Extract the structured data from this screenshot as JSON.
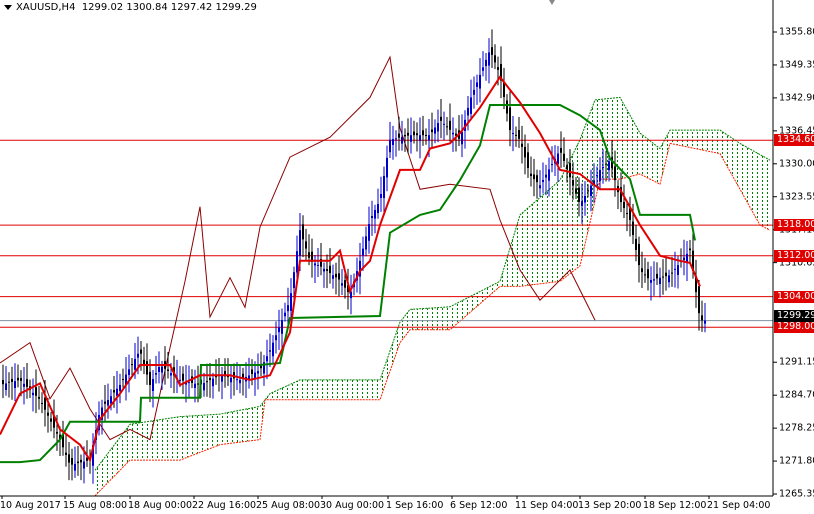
{
  "header": {
    "symbol": "XAUUSD,H4",
    "open": "1299.02",
    "high": "1300.84",
    "low": "1297.42",
    "close": "1299.29"
  },
  "chart_data": {
    "type": "candlestick",
    "title": "XAUUSD,H4",
    "ylim": [
      1262.5,
      1362.0
    ],
    "y_ticks": [
      "1355.80",
      "1349.35",
      "1342.90",
      "1336.45",
      "1330.00",
      "1323.55",
      "1317.10",
      "1310.65",
      "1291.15",
      "1284.70",
      "1278.25",
      "1271.80",
      "1265.35"
    ],
    "x_labels": [
      "10 Aug 2017",
      "15 Aug 08:00",
      "18 Aug 00:00",
      "22 Aug 16:00",
      "25 Aug 08:00",
      "30 Aug 00:00",
      "1 Sep 16:00",
      "6 Sep 12:00",
      "11 Sep 04:00",
      "13 Sep 20:00",
      "18 Sep 12:00",
      "21 Sep 04:00"
    ],
    "x_unit_note": "x in tens-of-bar units from left edge",
    "price_path": [
      [
        0,
        1286.7
      ],
      [
        2,
        1287.7
      ],
      [
        4,
        1283.8
      ],
      [
        6,
        1276
      ],
      [
        7,
        1271
      ],
      [
        9,
        1272
      ],
      [
        10,
        1281.8
      ],
      [
        12,
        1286.7
      ],
      [
        14,
        1293.5
      ],
      [
        15,
        1286.7
      ],
      [
        16,
        1290.6
      ],
      [
        18,
        1287.7
      ],
      [
        20,
        1286.7
      ],
      [
        22,
        1288.6
      ],
      [
        24,
        1287.7
      ],
      [
        26,
        1289.6
      ],
      [
        27,
        1293.5
      ],
      [
        29,
        1303.3
      ],
      [
        30,
        1317
      ],
      [
        31,
        1311
      ],
      [
        32,
        1310
      ],
      [
        34,
        1307.2
      ],
      [
        35,
        1304.3
      ],
      [
        36,
        1311
      ],
      [
        37,
        1319
      ],
      [
        38,
        1322.9
      ],
      [
        39,
        1334.7
      ],
      [
        41,
        1335.6
      ],
      [
        43,
        1335.6
      ],
      [
        44,
        1338.6
      ],
      [
        46,
        1334.7
      ],
      [
        47,
        1342.5
      ],
      [
        49,
        1352.3
      ],
      [
        50,
        1347.4
      ],
      [
        51,
        1336.6
      ],
      [
        52,
        1334.7
      ],
      [
        53,
        1327.8
      ],
      [
        54,
        1325.8
      ],
      [
        56,
        1332.7
      ],
      [
        58,
        1322
      ],
      [
        60,
        1328.8
      ],
      [
        61,
        1330.7
      ],
      [
        62,
        1322.9
      ],
      [
        63,
        1319
      ],
      [
        64,
        1309.2
      ],
      [
        65,
        1307.2
      ],
      [
        67,
        1308.2
      ],
      [
        69,
        1313.1
      ],
      [
        70,
        1299.4
      ],
      [
        70.5,
        1299.3
      ]
    ],
    "tenkan": [
      [
        0,
        1277
      ],
      [
        2,
        1285
      ],
      [
        4,
        1287
      ],
      [
        6,
        1278
      ],
      [
        8,
        1275
      ],
      [
        9,
        1272
      ],
      [
        10,
        1280
      ],
      [
        12,
        1285
      ],
      [
        14,
        1290.6
      ],
      [
        17,
        1290.6
      ],
      [
        18,
        1286.7
      ],
      [
        20,
        1288.6
      ],
      [
        23,
        1288.6
      ],
      [
        25,
        1287.7
      ],
      [
        27,
        1288.6
      ],
      [
        29,
        1297
      ],
      [
        30,
        1311
      ],
      [
        33,
        1311
      ],
      [
        34,
        1313
      ],
      [
        35,
        1305
      ],
      [
        36,
        1309
      ],
      [
        37,
        1311
      ],
      [
        38,
        1318
      ],
      [
        40,
        1328.8
      ],
      [
        42,
        1328.8
      ],
      [
        43,
        1333
      ],
      [
        45,
        1334
      ],
      [
        46,
        1336
      ],
      [
        48,
        1341
      ],
      [
        50,
        1347
      ],
      [
        52,
        1342
      ],
      [
        54,
        1336
      ],
      [
        56,
        1328.8
      ],
      [
        58,
        1328
      ],
      [
        60,
        1325
      ],
      [
        62,
        1325
      ],
      [
        64,
        1318
      ],
      [
        66,
        1312
      ],
      [
        68,
        1311
      ],
      [
        69,
        1310.6
      ],
      [
        70,
        1306
      ]
    ],
    "kijun": [
      [
        0,
        1271.6
      ],
      [
        2,
        1271.6
      ],
      [
        4,
        1272
      ],
      [
        6,
        1276
      ],
      [
        7,
        1279.5
      ],
      [
        14,
        1279.5
      ],
      [
        14.1,
        1284.2
      ],
      [
        20,
        1284.2
      ],
      [
        20.1,
        1290.6
      ],
      [
        26,
        1290.6
      ],
      [
        28,
        1291
      ],
      [
        29,
        1299.8
      ],
      [
        38,
        1300.2
      ],
      [
        39,
        1316.5
      ],
      [
        42,
        1320
      ],
      [
        44,
        1321
      ],
      [
        46,
        1326.8
      ],
      [
        48,
        1333.6
      ],
      [
        49,
        1341.5
      ],
      [
        56,
        1341.5
      ],
      [
        58,
        1339.5
      ],
      [
        60,
        1336.6
      ],
      [
        61,
        1331
      ],
      [
        63,
        1327
      ],
      [
        64,
        1320
      ],
      [
        69,
        1320
      ],
      [
        69.5,
        1315
      ]
    ],
    "span_a": [
      [
        9.5,
        1270
      ],
      [
        13,
        1279
      ],
      [
        18,
        1280.5
      ],
      [
        22,
        1281
      ],
      [
        26,
        1282.5
      ],
      [
        27,
        1285
      ],
      [
        30,
        1287.7
      ],
      [
        38,
        1287.7
      ],
      [
        40,
        1299
      ],
      [
        41,
        1301.5
      ],
      [
        45,
        1302
      ],
      [
        50,
        1307
      ],
      [
        52,
        1320
      ],
      [
        56,
        1326.8
      ],
      [
        58,
        1334.7
      ],
      [
        59.5,
        1342.5
      ],
      [
        62,
        1343
      ],
      [
        64,
        1336
      ],
      [
        66,
        1333
      ],
      [
        67,
        1336.6
      ],
      [
        72,
        1336.6
      ],
      [
        74,
        1334
      ],
      [
        77,
        1330.7
      ]
    ],
    "span_b": [
      [
        9.5,
        1265
      ],
      [
        13,
        1272
      ],
      [
        18,
        1272
      ],
      [
        22,
        1275
      ],
      [
        26,
        1276
      ],
      [
        26.5,
        1283.8
      ],
      [
        30,
        1283.8
      ],
      [
        38,
        1283.8
      ],
      [
        40,
        1295
      ],
      [
        41,
        1297.5
      ],
      [
        45,
        1297.5
      ],
      [
        50,
        1306
      ],
      [
        52,
        1306
      ],
      [
        56,
        1307
      ],
      [
        58,
        1310
      ],
      [
        60,
        1327
      ],
      [
        62,
        1327
      ],
      [
        64,
        1328
      ],
      [
        66,
        1326
      ],
      [
        67,
        1334
      ],
      [
        72,
        1332
      ],
      [
        74,
        1325
      ],
      [
        76,
        1318
      ],
      [
        77,
        1317
      ]
    ],
    "chikou": [
      [
        0,
        1291
      ],
      [
        3,
        1295
      ],
      [
        5,
        1284
      ],
      [
        7,
        1290
      ],
      [
        9,
        1282
      ],
      [
        11,
        1276
      ],
      [
        13,
        1278
      ],
      [
        15,
        1276
      ],
      [
        17,
        1294
      ],
      [
        18.5,
        1307
      ],
      [
        20,
        1321.6
      ],
      [
        21,
        1300
      ],
      [
        23,
        1307.7
      ],
      [
        24.5,
        1301.9
      ],
      [
        26,
        1317.6
      ],
      [
        29,
        1331.3
      ],
      [
        33,
        1335.2
      ],
      [
        37,
        1343
      ],
      [
        39,
        1350.9
      ],
      [
        40,
        1337
      ],
      [
        42,
        1325
      ],
      [
        45,
        1326
      ],
      [
        49,
        1325
      ],
      [
        50,
        1319
      ],
      [
        52,
        1309.2
      ],
      [
        54,
        1303.3
      ],
      [
        57,
        1309.2
      ],
      [
        59.5,
        1299.4
      ]
    ],
    "levels": [
      {
        "price": 1334.6,
        "label": "1334.60"
      },
      {
        "price": 1318.0,
        "label": "1318.00"
      },
      {
        "price": 1312.0,
        "label": "1312.00"
      },
      {
        "price": 1304.0,
        "label": "1304.00"
      },
      {
        "price": 1298.0,
        "label": "1298.00"
      }
    ],
    "bid": {
      "price": 1299.29,
      "label": "1299.29"
    },
    "colors": {
      "up": "#0000cc",
      "down": "#000000",
      "tenkan": "#e00000",
      "kijun": "#008000",
      "chikou": "#8b0000",
      "cloud_bull": "#008000",
      "cloud_bear": "#ff2000",
      "level": "#e00000"
    }
  }
}
